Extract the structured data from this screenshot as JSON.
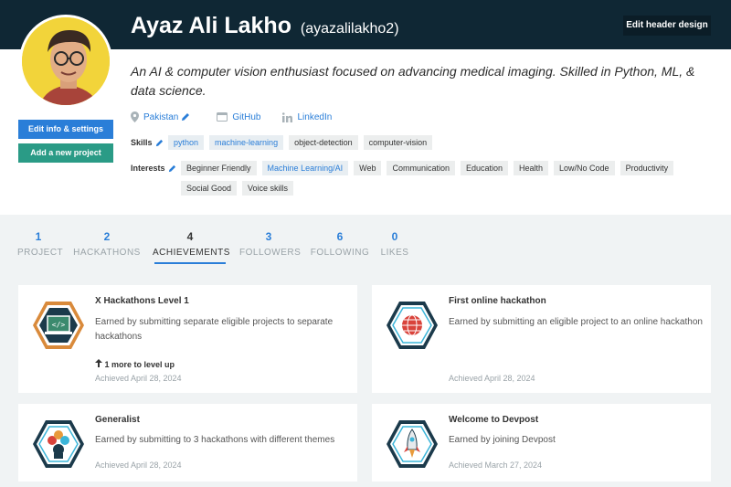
{
  "header": {
    "name": "Ayaz Ali Lakho",
    "username": "(ayazalilakho2)",
    "edit_header_label": "Edit header design"
  },
  "profile": {
    "bio": "An AI & computer vision enthusiast focused on advancing medical imaging. Skilled in Python, ML, & data science.",
    "buttons": {
      "edit_info": "Edit info & settings",
      "add_project": "Add a new project"
    },
    "links": {
      "location": "Pakistan",
      "github": "GitHub",
      "linkedin": "LinkedIn"
    },
    "skills_label": "Skills",
    "skills": [
      "python",
      "machine-learning",
      "object-detection",
      "computer-vision"
    ],
    "interests_label": "Interests",
    "interests": [
      "Beginner Friendly",
      "Machine Learning/AI",
      "Web",
      "Communication",
      "Education",
      "Health",
      "Low/No Code",
      "Productivity",
      "Social Good",
      "Voice skills"
    ]
  },
  "stats": [
    {
      "count": "1",
      "label": "PROJECT"
    },
    {
      "count": "2",
      "label": "HACKATHONS"
    },
    {
      "count": "4",
      "label": "ACHIEVEMENTS"
    },
    {
      "count": "3",
      "label": "FOLLOWERS"
    },
    {
      "count": "6",
      "label": "FOLLOWING"
    },
    {
      "count": "0",
      "label": "LIKES"
    }
  ],
  "achievements": [
    {
      "title": "X Hackathons Level 1",
      "description": "Earned by submitting separate eligible projects to separate hackathons",
      "level_up": "1 more to level up",
      "date": "Achieved April 28, 2024"
    },
    {
      "title": "First online hackathon",
      "description": "Earned by submitting an eligible project to an online hackathon",
      "date": "Achieved April 28, 2024"
    },
    {
      "title": "Generalist",
      "description": "Earned by submitting to 3 hackathons with different themes",
      "date": "Achieved April 28, 2024"
    },
    {
      "title": "Welcome to Devpost",
      "description": "Earned by joining Devpost",
      "date": "Achieved March 27, 2024"
    }
  ],
  "colors": {
    "header_bg": "#0f2734",
    "accent_blue": "#2a7ed8",
    "accent_green": "#2a9b86",
    "badge_orange": "#d98a3b",
    "badge_navy": "#1b3a4b",
    "badge_cyan": "#3bb5d9"
  },
  "icons": {
    "location": "map-pin-icon",
    "github": "github-icon",
    "linkedin": "linkedin-icon",
    "edit": "pencil-icon",
    "level_up": "arrow-up-icon"
  }
}
